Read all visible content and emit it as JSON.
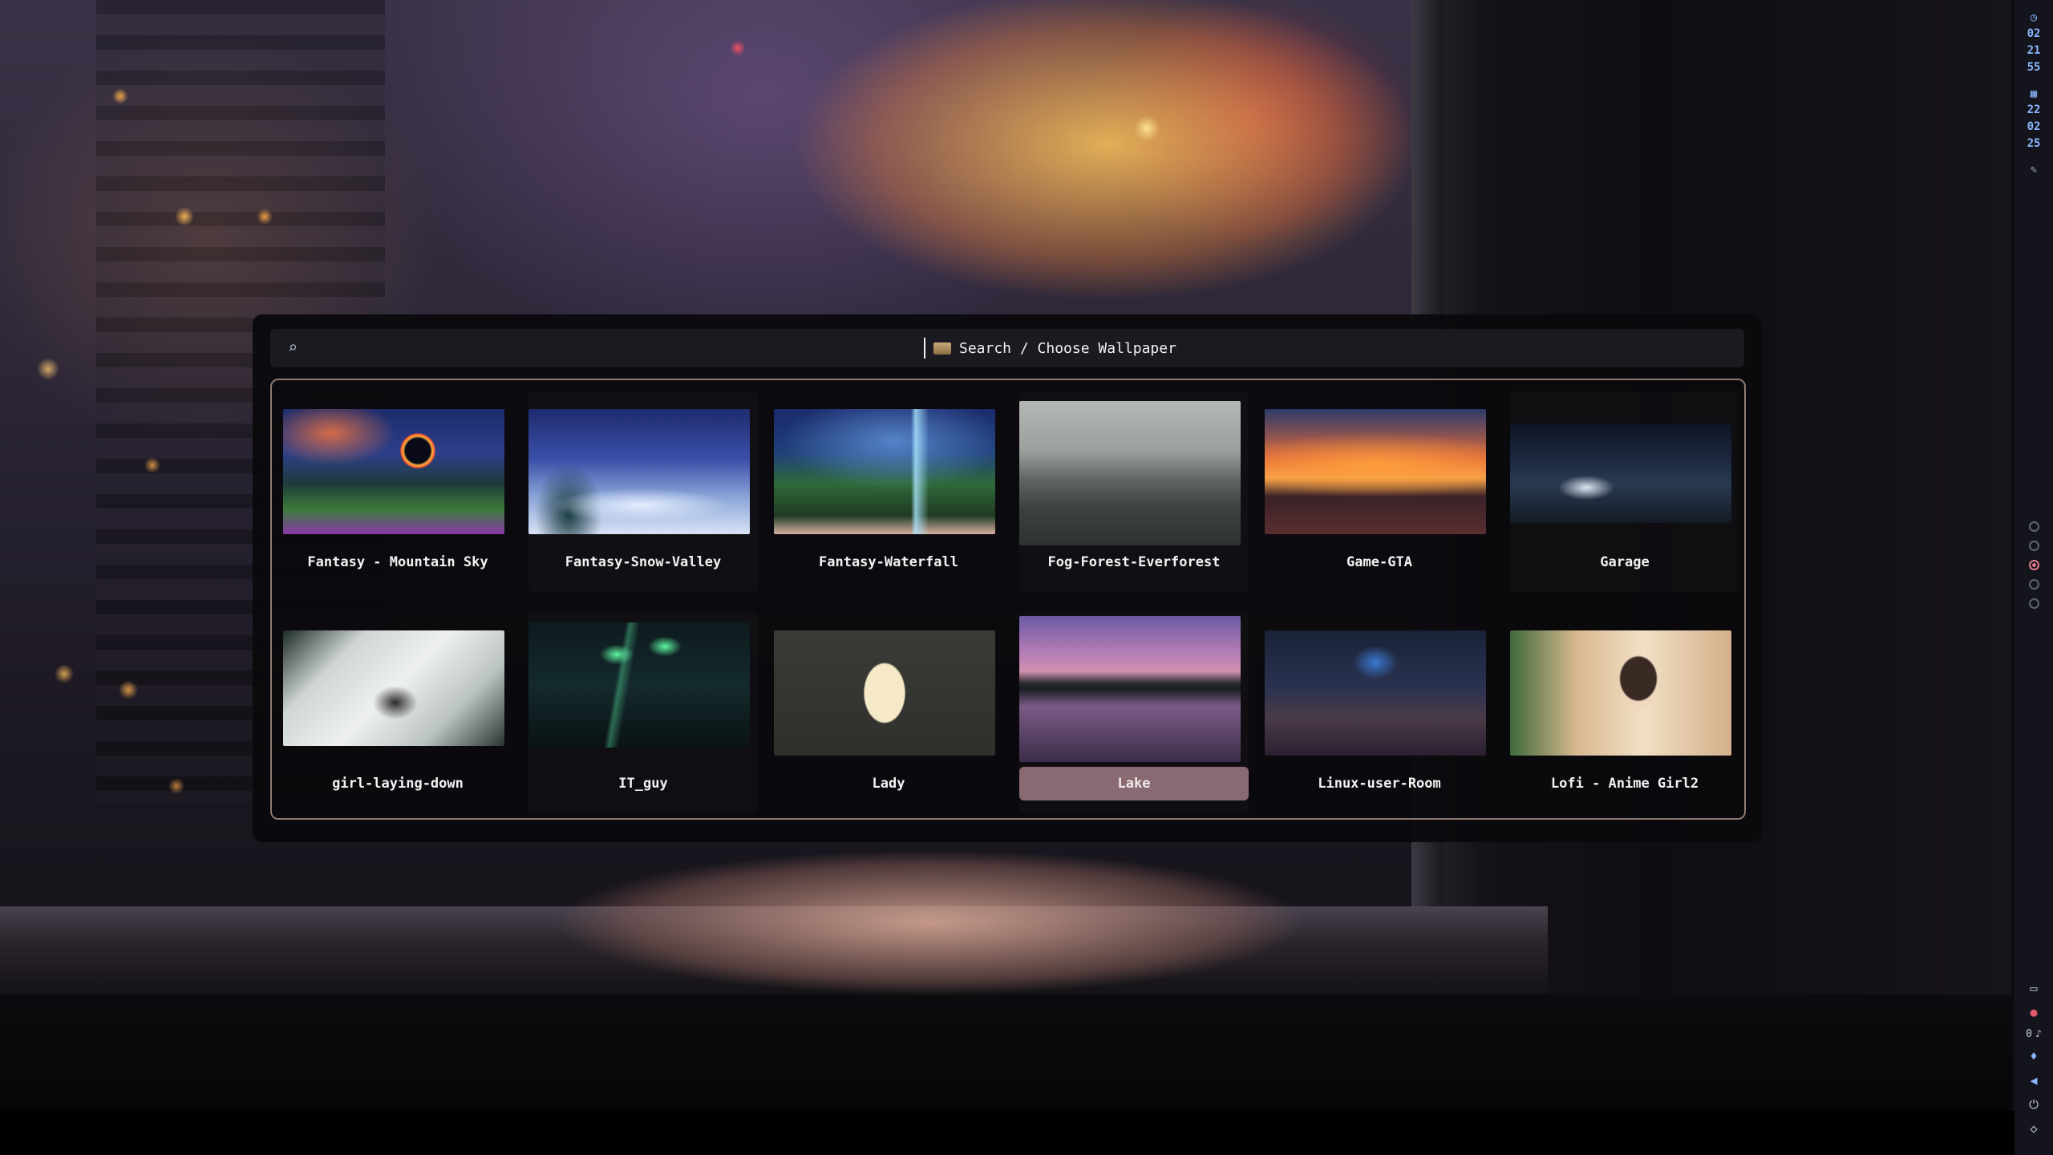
{
  "search": {
    "prompt": "Search / Choose Wallpaper"
  },
  "wallpapers": [
    {
      "label": "Fantasy - Mountain Sky"
    },
    {
      "label": "Fantasy-Snow-Valley"
    },
    {
      "label": "Fantasy-Waterfall"
    },
    {
      "label": "Fog-Forest-Everforest"
    },
    {
      "label": "Game-GTA"
    },
    {
      "label": "Garage"
    },
    {
      "label": "girl-laying-down"
    },
    {
      "label": "IT_guy"
    },
    {
      "label": "Lady"
    },
    {
      "label": "Lake",
      "selected": true
    },
    {
      "label": "Linux-user-Room"
    },
    {
      "label": "Lofi - Anime Girl2"
    }
  ],
  "sidebar": {
    "clock": [
      "02",
      "21",
      "55"
    ],
    "date": [
      "22",
      "02",
      "25"
    ],
    "workspaces": 5,
    "active_workspace": 3,
    "notifications_count": "0"
  },
  "colors": {
    "selection": "#8a6a72",
    "border": "#8c7a70",
    "sidebar_accent": "#8bb7ff"
  }
}
